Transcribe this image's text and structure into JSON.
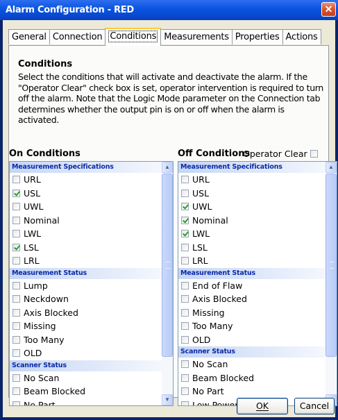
{
  "window": {
    "title": "Alarm Configuration - RED",
    "close_glyph": "✕"
  },
  "tabs": [
    {
      "label": "General"
    },
    {
      "label": "Connection"
    },
    {
      "label": "Conditions",
      "active": true
    },
    {
      "label": "Measurements"
    },
    {
      "label": "Properties"
    },
    {
      "label": "Actions"
    }
  ],
  "conditions": {
    "title": "Conditions",
    "description": "Select the conditions that will activate and deactivate the alarm.  If the \"Operator Clear\" check box is set, operator intervention is required to turn off the alarm. Note that the Logic Mode parameter on the Connection tab determines whether the output pin  is on or off when the alarm is activated."
  },
  "on_conditions": {
    "title": "On Conditions",
    "groups": [
      {
        "header": "Measurement Specifications",
        "items": [
          {
            "label": "URL",
            "checked": false
          },
          {
            "label": "USL",
            "checked": true
          },
          {
            "label": "UWL",
            "checked": false
          },
          {
            "label": "Nominal",
            "checked": false
          },
          {
            "label": "LWL",
            "checked": false
          },
          {
            "label": "LSL",
            "checked": true
          },
          {
            "label": "LRL",
            "checked": false
          }
        ]
      },
      {
        "header": "Measurement Status",
        "items": [
          {
            "label": "Lump",
            "checked": false
          },
          {
            "label": "Neckdown",
            "checked": false
          },
          {
            "label": "Axis Blocked",
            "checked": false
          },
          {
            "label": "Missing",
            "checked": false
          },
          {
            "label": "Too Many",
            "checked": false
          },
          {
            "label": "OLD",
            "checked": false
          }
        ]
      },
      {
        "header": "Scanner Status",
        "items": [
          {
            "label": "No Scan",
            "checked": false
          },
          {
            "label": "Beam Blocked",
            "checked": false
          },
          {
            "label": "No Part",
            "checked": false
          }
        ]
      }
    ]
  },
  "off_conditions": {
    "title": "Off Conditions",
    "operator_clear_label": "Operator Clear",
    "operator_clear_checked": false,
    "groups": [
      {
        "header": "Measurement Specifications",
        "items": [
          {
            "label": "URL",
            "checked": false
          },
          {
            "label": "USL",
            "checked": false
          },
          {
            "label": "UWL",
            "checked": true
          },
          {
            "label": "Nominal",
            "checked": true
          },
          {
            "label": "LWL",
            "checked": true
          },
          {
            "label": "LSL",
            "checked": false
          },
          {
            "label": "LRL",
            "checked": false
          }
        ]
      },
      {
        "header": "Measurement Status",
        "items": [
          {
            "label": "End of Flaw",
            "checked": false
          },
          {
            "label": "Axis Blocked",
            "checked": false
          },
          {
            "label": "Missing",
            "checked": false
          },
          {
            "label": "Too Many",
            "checked": false
          },
          {
            "label": "OLD",
            "checked": false
          }
        ]
      },
      {
        "header": "Scanner Status",
        "items": [
          {
            "label": "No Scan",
            "checked": false
          },
          {
            "label": "Beam Blocked",
            "checked": false
          },
          {
            "label": "No Part",
            "checked": false
          },
          {
            "label": "Low Power",
            "checked": false
          }
        ]
      }
    ]
  },
  "buttons": {
    "ok": "OK",
    "cancel": "Cancel"
  },
  "colors": {
    "title_bar": "#0b56e0",
    "group_header_text": "#0b2aa8",
    "checkmark": "#21a121",
    "dialog_bg": "#ece9d8"
  }
}
